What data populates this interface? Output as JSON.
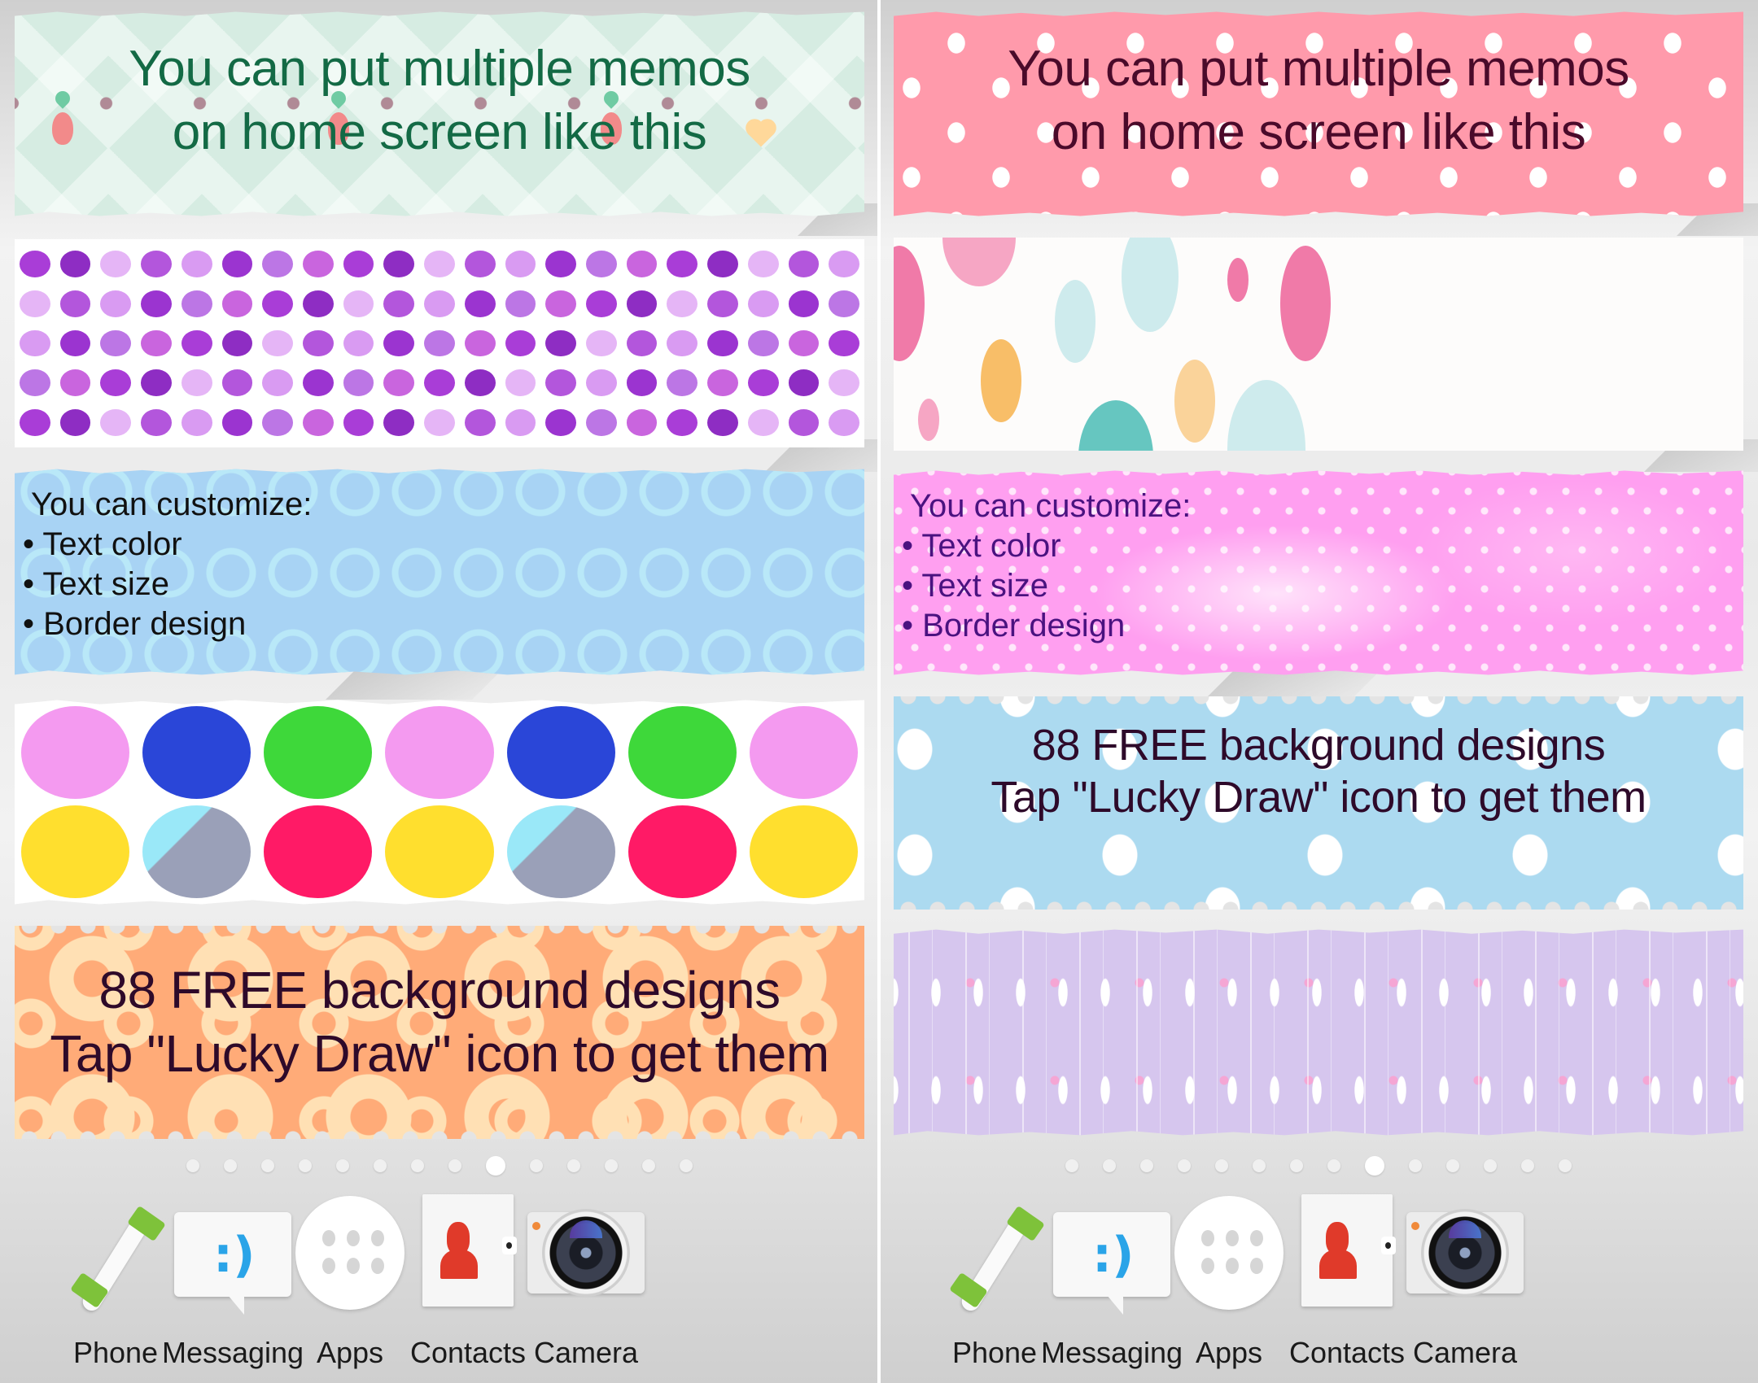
{
  "screens": [
    {
      "id": "left",
      "memos": [
        {
          "type": "title",
          "lines": [
            "You can put multiple memos",
            "on home screen like this"
          ],
          "text_color": "#136a45",
          "background": "mint-diamond-flower"
        },
        {
          "type": "pattern",
          "background": "purple-watercolor-dots"
        },
        {
          "type": "list",
          "heading": "You can customize:",
          "items": [
            "Text color",
            "Text size",
            "Border design"
          ],
          "bullet": "•",
          "text_color": "#111111",
          "background": "blue-rings"
        },
        {
          "type": "pattern",
          "background": "rainbow-watercolor-circles"
        },
        {
          "type": "title",
          "lines": [
            "88 FREE background designs",
            "Tap \"Lucky Draw\" icon to get them"
          ],
          "text_color": "#2e0a2a",
          "background": "orange-rings"
        }
      ]
    },
    {
      "id": "right",
      "memos": [
        {
          "type": "title",
          "lines": [
            "You can put multiple memos",
            "on home screen like this"
          ],
          "text_color": "#4a0a2a",
          "background": "pink-polka"
        },
        {
          "type": "pattern",
          "background": "pastel-big-dots"
        },
        {
          "type": "list",
          "heading": "You can customize:",
          "items": [
            "Text color",
            "Text size",
            "Border design"
          ],
          "bullet": "•",
          "text_color": "#4a1280",
          "background": "pink-watercolor-dots"
        },
        {
          "type": "title",
          "lines": [
            "88 FREE background designs",
            "Tap \"Lucky Draw\" icon to get them"
          ],
          "text_color": "#2e0a2a",
          "background": "lightblue-polka"
        },
        {
          "type": "pattern",
          "background": "lavender-floral"
        }
      ]
    }
  ],
  "pager": {
    "page_count": 14,
    "active_index": 8
  },
  "dock": [
    {
      "label": "Phone",
      "icon": "phone-icon"
    },
    {
      "label": "Messaging",
      "icon": "messaging-icon"
    },
    {
      "label": "Apps",
      "icon": "apps-grid-icon"
    },
    {
      "label": "Contacts",
      "icon": "contacts-icon"
    },
    {
      "label": "Camera",
      "icon": "camera-icon"
    }
  ],
  "colors": {
    "mint": "#d6ece2",
    "pink": "#ff9aab",
    "sky_blue": "#a8d3f4",
    "hot_pink": "#ff9ff0",
    "light_blue": "#acdaf0",
    "orange": "#ffab78",
    "lavender": "#d6c6ee",
    "green_text": "#136a45"
  }
}
